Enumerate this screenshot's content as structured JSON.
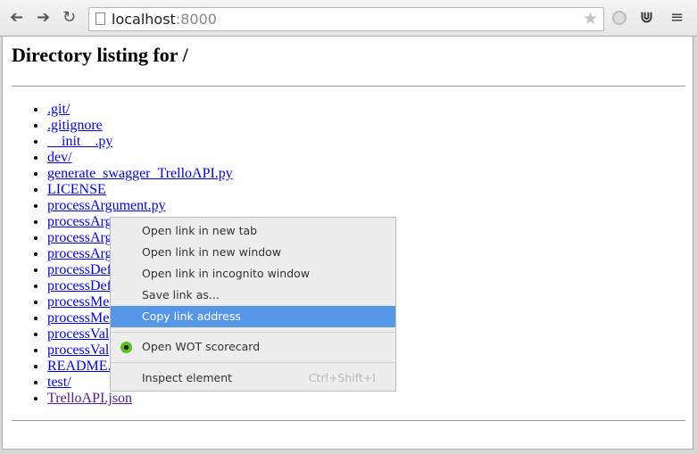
{
  "toolbar": {
    "url_host": "localhost",
    "url_port": ":8000",
    "back_icon": "arrow-left-icon",
    "forward_icon": "arrow-right-icon",
    "reload_icon": "reload-icon",
    "bookmark_icon": "star-icon",
    "menu_icon": "hamburger-icon"
  },
  "page": {
    "title": "Directory listing for /",
    "items": [
      {
        "label": ".git/",
        "visited": false
      },
      {
        "label": ".gitignore",
        "visited": false
      },
      {
        "label": "__init__.py",
        "visited": false
      },
      {
        "label": "dev/",
        "visited": false
      },
      {
        "label": "generate_swagger_TrelloAPI.py",
        "visited": false
      },
      {
        "label": "LICENSE",
        "visited": false
      },
      {
        "label": "processArgument.py",
        "visited": false
      },
      {
        "label": "processArg",
        "visited": false
      },
      {
        "label": "processArg",
        "visited": false
      },
      {
        "label": "processArg",
        "visited": false
      },
      {
        "label": "processDef",
        "visited": false
      },
      {
        "label": "processDef",
        "visited": false
      },
      {
        "label": "processMet",
        "visited": false
      },
      {
        "label": "processMet",
        "visited": false
      },
      {
        "label": "processVal",
        "visited": false
      },
      {
        "label": "processVal",
        "visited": false
      },
      {
        "label": "README.",
        "visited": false
      },
      {
        "label": "test/",
        "visited": false
      },
      {
        "label": "TrelloAPI.json",
        "visited": true
      }
    ]
  },
  "context_menu": {
    "open_new_tab": "Open link in new tab",
    "open_new_window": "Open link in new window",
    "open_incognito": "Open link in incognito window",
    "save_link": "Save link as...",
    "copy_link": "Copy link address",
    "wot": "Open WOT scorecard",
    "inspect": "Inspect element",
    "inspect_shortcut": "Ctrl+Shift+I",
    "highlight_color": "#5596e6"
  }
}
